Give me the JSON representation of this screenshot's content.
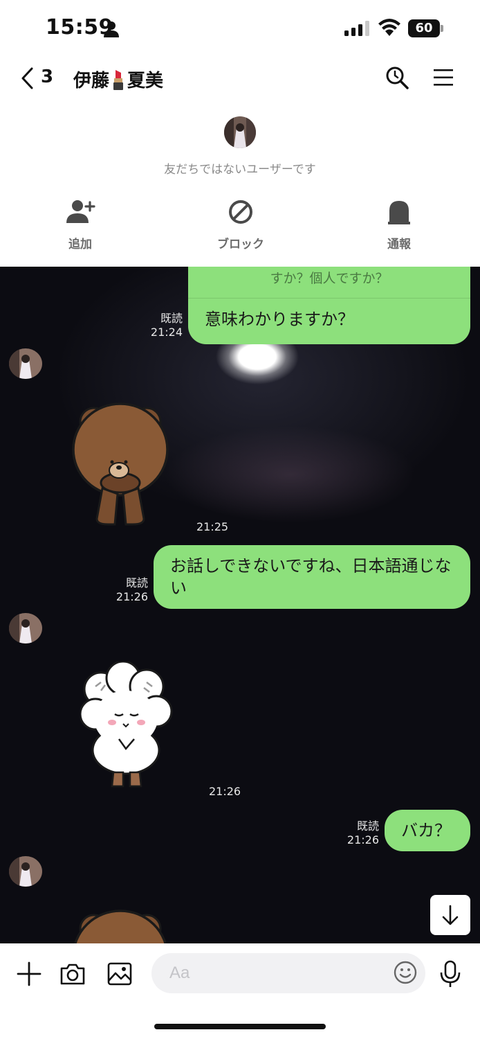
{
  "status_bar": {
    "time": "15:59",
    "battery": "60"
  },
  "header": {
    "unread_count": "3",
    "name_part1": "伊藤",
    "name_part2": "夏美"
  },
  "info_panel": {
    "notice": "友だちではないユーザーです",
    "actions": [
      {
        "label": "追加",
        "icon": "add-friend-icon"
      },
      {
        "label": "ブロック",
        "icon": "block-icon"
      },
      {
        "label": "通報",
        "icon": "report-icon"
      }
    ]
  },
  "messages": [
    {
      "side": "right",
      "type": "text",
      "quote": "すか？個人ですか？",
      "text": "意味わかりますか？",
      "read": "既読",
      "time": "21:24"
    },
    {
      "side": "left",
      "type": "sticker",
      "sticker": "brown-bear-bow-sticker",
      "time": "21:25"
    },
    {
      "side": "right",
      "type": "text",
      "text": "お話しできないですね、日本語通じない",
      "read": "既読",
      "time": "21:26"
    },
    {
      "side": "left",
      "type": "sticker",
      "sticker": "white-sheep-bow-sticker",
      "time": "21:26"
    },
    {
      "side": "right",
      "type": "text",
      "text": "バカ？",
      "read": "既読",
      "time": "21:26"
    },
    {
      "side": "left",
      "type": "sticker",
      "sticker": "brown-bear-sticker-partial",
      "time": ""
    }
  ],
  "input_bar": {
    "placeholder": "Aa"
  },
  "colors": {
    "bubble_green": "#8de07c",
    "chat_background": "#0c0c12",
    "panel_label": "#6b6b6b"
  }
}
